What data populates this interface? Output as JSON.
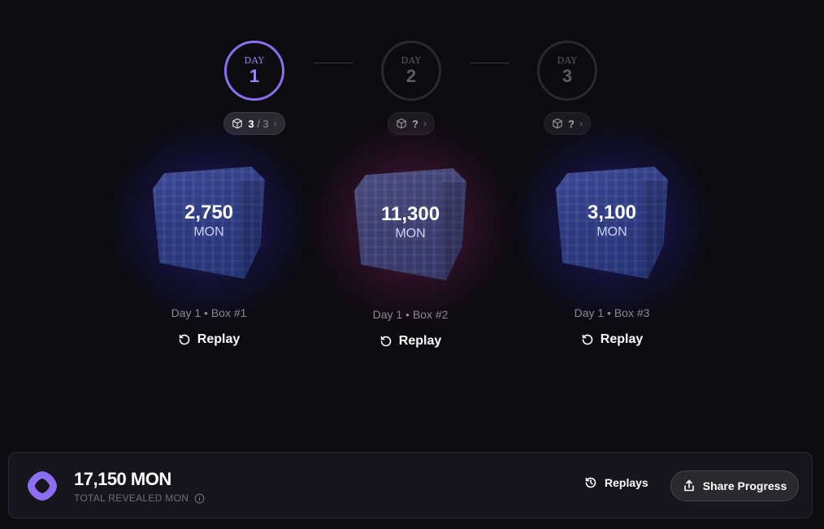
{
  "stepper": {
    "days": [
      {
        "word": "DAY",
        "number": "1",
        "count": "3",
        "total": "/ 3",
        "active": true
      },
      {
        "word": "DAY",
        "number": "2",
        "count": "?",
        "total": "",
        "active": false
      },
      {
        "word": "DAY",
        "number": "3",
        "count": "?",
        "total": "",
        "active": false
      }
    ]
  },
  "boxes": [
    {
      "amount": "2,750",
      "unit": "MON",
      "label": "Day 1 • Box #1",
      "replay": "Replay",
      "glow": "blue"
    },
    {
      "amount": "11,300",
      "unit": "MON",
      "label": "Day 1 • Box #2",
      "replay": "Replay",
      "glow": "pink"
    },
    {
      "amount": "3,100",
      "unit": "MON",
      "label": "Day 1 • Box #3",
      "replay": "Replay",
      "glow": "blue"
    }
  ],
  "footer": {
    "total_value": "17,150 MON",
    "total_label": "TOTAL REVEALED MON",
    "replays_label": "Replays",
    "share_label": "Share Progress"
  },
  "colors": {
    "accent": "#8b6ff0",
    "background": "#0c0b0f",
    "panel": "#16151b"
  }
}
